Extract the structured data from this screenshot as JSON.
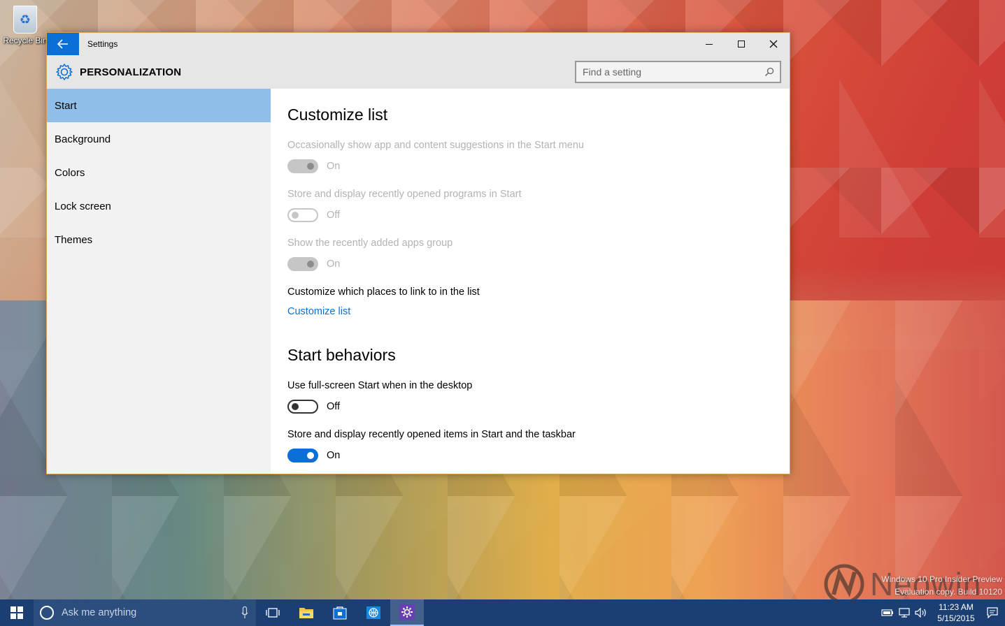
{
  "desktop": {
    "recycle_bin_label": "Recycle Bin"
  },
  "window": {
    "title": "Settings",
    "section": "PERSONALIZATION",
    "search_placeholder": "Find a setting",
    "controls": {
      "minimize": "minimize",
      "maximize": "maximize",
      "close": "close"
    }
  },
  "nav": {
    "items": [
      {
        "label": "Start",
        "selected": true
      },
      {
        "label": "Background",
        "selected": false
      },
      {
        "label": "Colors",
        "selected": false
      },
      {
        "label": "Lock screen",
        "selected": false
      },
      {
        "label": "Themes",
        "selected": false
      }
    ]
  },
  "content": {
    "customize_list": {
      "heading": "Customize list",
      "settings": [
        {
          "label": "Occasionally show app and content suggestions in the Start menu",
          "state": "On",
          "enabled": false
        },
        {
          "label": "Store and display recently opened programs in Start",
          "state": "Off",
          "enabled": false
        },
        {
          "label": "Show the recently added apps group",
          "state": "On",
          "enabled": false
        }
      ],
      "places_label": "Customize which places to link to in the list",
      "places_link": "Customize list"
    },
    "start_behaviors": {
      "heading": "Start behaviors",
      "settings": [
        {
          "label": "Use full-screen Start when in the desktop",
          "state": "Off",
          "enabled": true
        },
        {
          "label": "Store and display recently opened items in Start and the taskbar",
          "state": "On",
          "enabled": true
        }
      ]
    }
  },
  "watermark": {
    "line1": "Windows 10 Pro Insider Preview",
    "line2": "Evaluation copy. Build 10120",
    "brand": "Neowin"
  },
  "taskbar": {
    "search_placeholder": "Ask me anything",
    "clock_time": "11:23 AM",
    "clock_date": "5/15/2015"
  },
  "colors": {
    "accent": "#0a6fd6",
    "nav_selected": "#8fbfe8",
    "taskbar": "#1b3f73"
  }
}
